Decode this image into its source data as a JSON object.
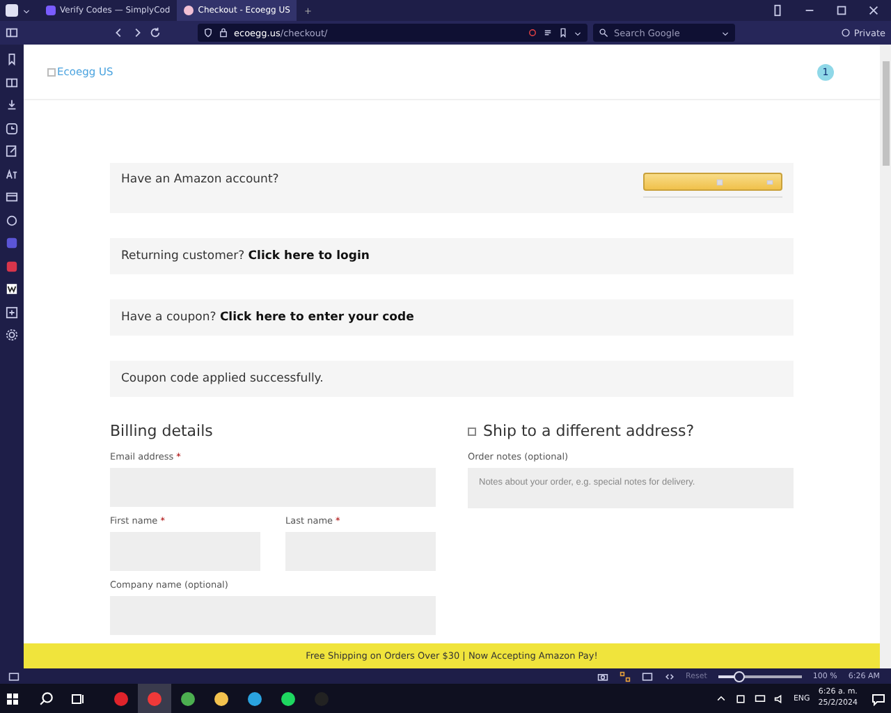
{
  "browser": {
    "tabs": [
      {
        "title": "Verify Codes — SimplyCod",
        "selected": false
      },
      {
        "title": "Checkout - Ecoegg US",
        "selected": true
      }
    ],
    "new_tab": "+",
    "address": {
      "domain": "ecoegg.us",
      "path": "/checkout/"
    },
    "search": {
      "placeholder": "Search Google"
    },
    "private_label": "Private"
  },
  "page": {
    "logo_alt": "Ecoegg US",
    "cart_count": "1",
    "notices": [
      {
        "kind": "amazon",
        "text": "Have an Amazon account?"
      },
      {
        "kind": "plain",
        "text": "Returning customer? **Click here to login**"
      },
      {
        "kind": "plain",
        "text": "Have a coupon? **Click here to enter your code**"
      },
      {
        "kind": "plain",
        "text": "Coupon code applied successfully."
      }
    ],
    "billing": {
      "title": "Billing details",
      "required_mark": "*",
      "rows": [
        [
          {
            "label": "Email address",
            "required": true
          }
        ],
        [
          {
            "label": "First name",
            "required": true
          },
          {
            "label": "Last name",
            "required": true
          }
        ],
        [
          {
            "label": "Company name (optional)",
            "required": false
          }
        ]
      ]
    },
    "shipping": {
      "label": "Ship to a different address?",
      "checked": false
    },
    "order_notes": {
      "label": "Order notes (optional)",
      "placeholder": "Notes about your order, e.g. special notes for delivery."
    },
    "banner": "Free Shipping on Orders Over $30 | Now Accepting Amazon Pay!"
  },
  "status_bar": {
    "reset": "Reset",
    "zoom": {
      "level": 0.25
    },
    "zoom_text": "100 %",
    "clock": "6:26 AM"
  },
  "taskbar": {
    "language": "ENG",
    "time": "6:26 a. m.",
    "date": "25/2/2024"
  }
}
